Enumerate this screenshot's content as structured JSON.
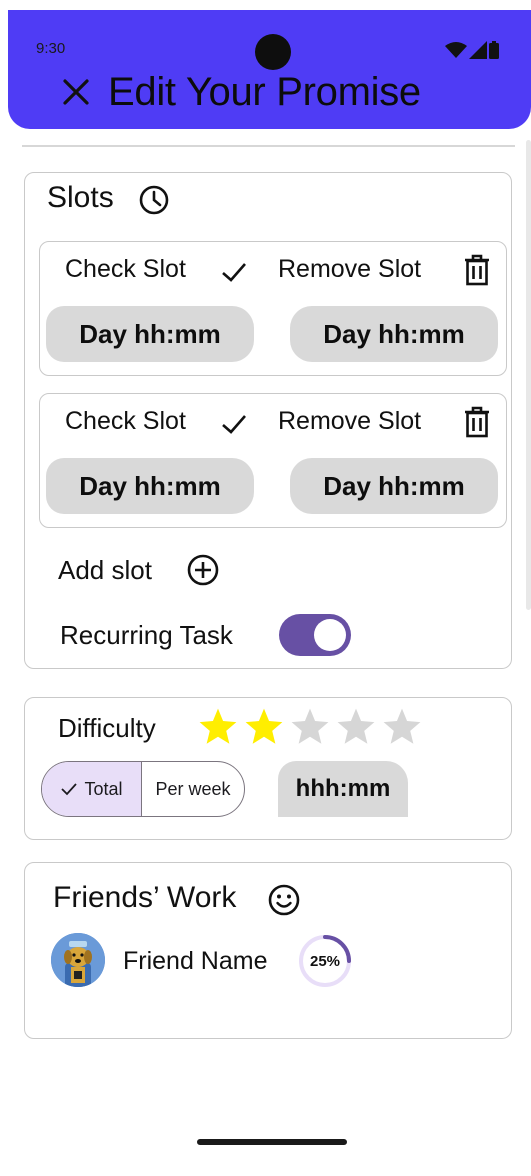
{
  "status_bar": {
    "time": "9:30"
  },
  "header": {
    "title": "Edit Your Promise",
    "close_icon": "close-icon"
  },
  "slots_section": {
    "title": "Slots",
    "slots": [
      {
        "check_label": "Check Slot",
        "remove_label": "Remove Slot",
        "start_placeholder": "Day hh:mm",
        "end_placeholder": "Day hh:mm"
      },
      {
        "check_label": "Check Slot",
        "remove_label": "Remove Slot",
        "start_placeholder": "Day hh:mm",
        "end_placeholder": "Day hh:mm"
      }
    ],
    "add_slot_label": "Add slot",
    "recurring_label": "Recurring Task",
    "recurring_enabled": true
  },
  "difficulty_section": {
    "label": "Difficulty",
    "rating": 2,
    "max_rating": 5,
    "segments": [
      {
        "label": "Total",
        "selected": true
      },
      {
        "label": "Per week",
        "selected": false
      }
    ],
    "duration_placeholder": "hhh:mm"
  },
  "friends_section": {
    "title": "Friends’ Work",
    "friends": [
      {
        "name": "Friend Name",
        "progress_label": "25%",
        "progress": 0.25
      }
    ]
  },
  "colors": {
    "app_bar": "#4f3cf5",
    "toggle_on": "#6750a4",
    "star_filled": "#ffee00",
    "star_empty": "#d6d6d6",
    "segment_selected": "#e8def8",
    "field_bg": "#d9d9d9"
  }
}
